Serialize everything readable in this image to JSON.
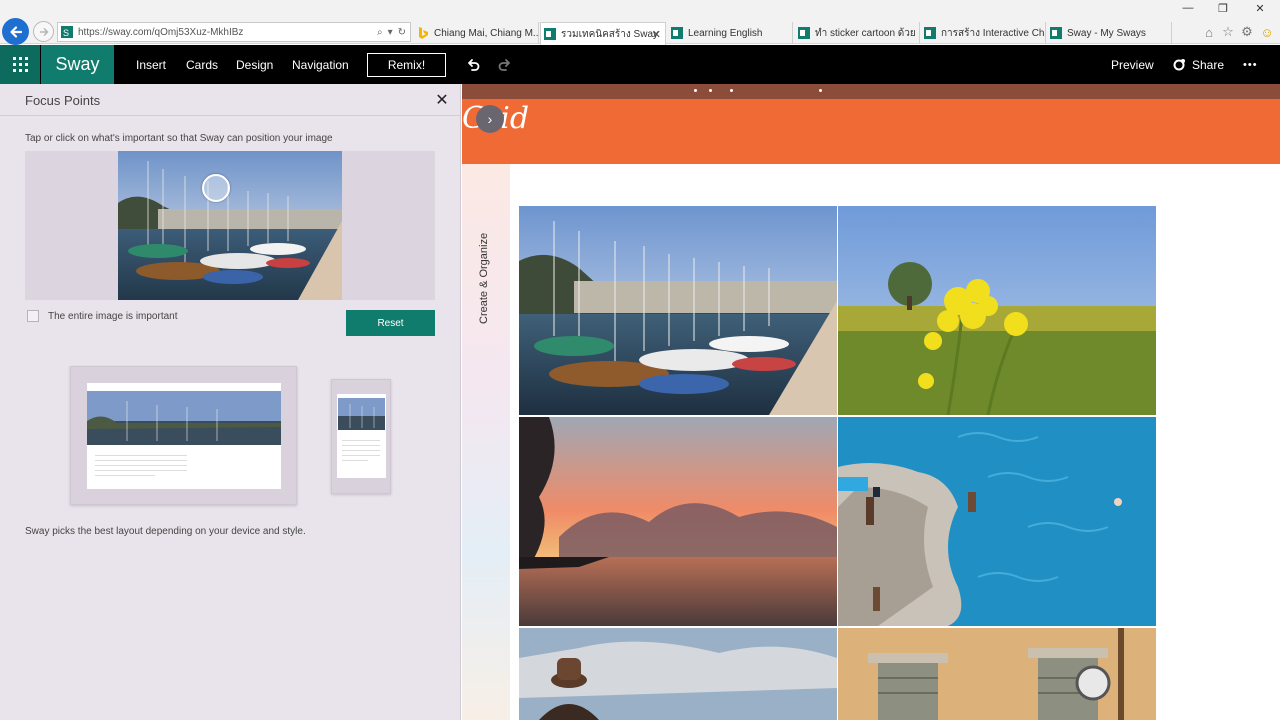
{
  "browser": {
    "url": "https://sway.com/qOmj53Xuz-MkhIBz",
    "tabs": [
      {
        "label": "Chiang Mai, Chiang M...",
        "icon": "bing-icon"
      },
      {
        "label": "รวมเทคนิคสร้าง Sway",
        "icon": "sway-icon",
        "active": true
      },
      {
        "label": "Learning English",
        "icon": "sway-icon"
      },
      {
        "label": "ทำ sticker cartoon ด้วย ...",
        "icon": "sway-icon"
      },
      {
        "label": "การสร้าง Interactive Cha...",
        "icon": "sway-icon"
      },
      {
        "label": "Sway - My Sways",
        "icon": "sway-icon"
      }
    ],
    "window_buttons": [
      "—",
      "❐",
      "✕"
    ],
    "tool_icons": [
      "home-icon",
      "star-icon",
      "gear-icon",
      "smiley-icon"
    ]
  },
  "app": {
    "brand": "Sway",
    "menu": [
      "Insert",
      "Cards",
      "Design",
      "Navigation"
    ],
    "remix": "Remix!",
    "preview": "Preview",
    "share": "Share",
    "more": "•••"
  },
  "panel": {
    "title": "Focus Points",
    "close": "✕",
    "instructions": "Tap or click on what's important so that Sway can position your image",
    "entire_image": "The entire image is important",
    "reset": "Reset",
    "note": "Sway picks the best layout depending on your device and style."
  },
  "canvas": {
    "title": "Grid",
    "side_label": "Create & Organize"
  },
  "colors": {
    "accent": "#107c6d",
    "title_band": "#f06a35",
    "panel_bg": "#e9e4ec"
  }
}
